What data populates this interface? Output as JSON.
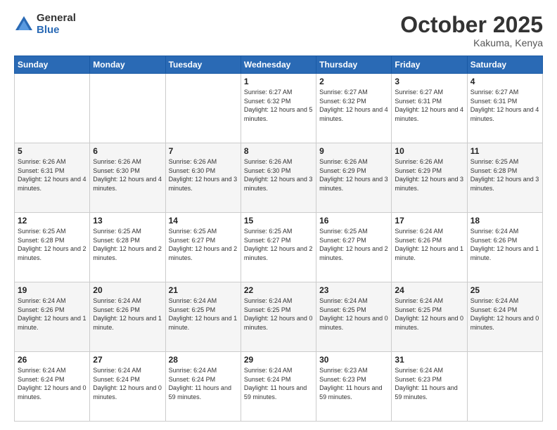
{
  "header": {
    "logo_general": "General",
    "logo_blue": "Blue",
    "month_title": "October 2025",
    "location": "Kakuma, Kenya"
  },
  "days_of_week": [
    "Sunday",
    "Monday",
    "Tuesday",
    "Wednesday",
    "Thursday",
    "Friday",
    "Saturday"
  ],
  "weeks": [
    [
      {
        "day": "",
        "info": ""
      },
      {
        "day": "",
        "info": ""
      },
      {
        "day": "",
        "info": ""
      },
      {
        "day": "1",
        "info": "Sunrise: 6:27 AM\nSunset: 6:32 PM\nDaylight: 12 hours\nand 5 minutes."
      },
      {
        "day": "2",
        "info": "Sunrise: 6:27 AM\nSunset: 6:32 PM\nDaylight: 12 hours\nand 4 minutes."
      },
      {
        "day": "3",
        "info": "Sunrise: 6:27 AM\nSunset: 6:31 PM\nDaylight: 12 hours\nand 4 minutes."
      },
      {
        "day": "4",
        "info": "Sunrise: 6:27 AM\nSunset: 6:31 PM\nDaylight: 12 hours\nand 4 minutes."
      }
    ],
    [
      {
        "day": "5",
        "info": "Sunrise: 6:26 AM\nSunset: 6:31 PM\nDaylight: 12 hours\nand 4 minutes."
      },
      {
        "day": "6",
        "info": "Sunrise: 6:26 AM\nSunset: 6:30 PM\nDaylight: 12 hours\nand 4 minutes."
      },
      {
        "day": "7",
        "info": "Sunrise: 6:26 AM\nSunset: 6:30 PM\nDaylight: 12 hours\nand 3 minutes."
      },
      {
        "day": "8",
        "info": "Sunrise: 6:26 AM\nSunset: 6:30 PM\nDaylight: 12 hours\nand 3 minutes."
      },
      {
        "day": "9",
        "info": "Sunrise: 6:26 AM\nSunset: 6:29 PM\nDaylight: 12 hours\nand 3 minutes."
      },
      {
        "day": "10",
        "info": "Sunrise: 6:26 AM\nSunset: 6:29 PM\nDaylight: 12 hours\nand 3 minutes."
      },
      {
        "day": "11",
        "info": "Sunrise: 6:25 AM\nSunset: 6:28 PM\nDaylight: 12 hours\nand 3 minutes."
      }
    ],
    [
      {
        "day": "12",
        "info": "Sunrise: 6:25 AM\nSunset: 6:28 PM\nDaylight: 12 hours\nand 2 minutes."
      },
      {
        "day": "13",
        "info": "Sunrise: 6:25 AM\nSunset: 6:28 PM\nDaylight: 12 hours\nand 2 minutes."
      },
      {
        "day": "14",
        "info": "Sunrise: 6:25 AM\nSunset: 6:27 PM\nDaylight: 12 hours\nand 2 minutes."
      },
      {
        "day": "15",
        "info": "Sunrise: 6:25 AM\nSunset: 6:27 PM\nDaylight: 12 hours\nand 2 minutes."
      },
      {
        "day": "16",
        "info": "Sunrise: 6:25 AM\nSunset: 6:27 PM\nDaylight: 12 hours\nand 2 minutes."
      },
      {
        "day": "17",
        "info": "Sunrise: 6:24 AM\nSunset: 6:26 PM\nDaylight: 12 hours\nand 1 minute."
      },
      {
        "day": "18",
        "info": "Sunrise: 6:24 AM\nSunset: 6:26 PM\nDaylight: 12 hours\nand 1 minute."
      }
    ],
    [
      {
        "day": "19",
        "info": "Sunrise: 6:24 AM\nSunset: 6:26 PM\nDaylight: 12 hours\nand 1 minute."
      },
      {
        "day": "20",
        "info": "Sunrise: 6:24 AM\nSunset: 6:26 PM\nDaylight: 12 hours\nand 1 minute."
      },
      {
        "day": "21",
        "info": "Sunrise: 6:24 AM\nSunset: 6:25 PM\nDaylight: 12 hours\nand 1 minute."
      },
      {
        "day": "22",
        "info": "Sunrise: 6:24 AM\nSunset: 6:25 PM\nDaylight: 12 hours\nand 0 minutes."
      },
      {
        "day": "23",
        "info": "Sunrise: 6:24 AM\nSunset: 6:25 PM\nDaylight: 12 hours\nand 0 minutes."
      },
      {
        "day": "24",
        "info": "Sunrise: 6:24 AM\nSunset: 6:25 PM\nDaylight: 12 hours\nand 0 minutes."
      },
      {
        "day": "25",
        "info": "Sunrise: 6:24 AM\nSunset: 6:24 PM\nDaylight: 12 hours\nand 0 minutes."
      }
    ],
    [
      {
        "day": "26",
        "info": "Sunrise: 6:24 AM\nSunset: 6:24 PM\nDaylight: 12 hours\nand 0 minutes."
      },
      {
        "day": "27",
        "info": "Sunrise: 6:24 AM\nSunset: 6:24 PM\nDaylight: 12 hours\nand 0 minutes."
      },
      {
        "day": "28",
        "info": "Sunrise: 6:24 AM\nSunset: 6:24 PM\nDaylight: 11 hours\nand 59 minutes."
      },
      {
        "day": "29",
        "info": "Sunrise: 6:24 AM\nSunset: 6:24 PM\nDaylight: 11 hours\nand 59 minutes."
      },
      {
        "day": "30",
        "info": "Sunrise: 6:23 AM\nSunset: 6:23 PM\nDaylight: 11 hours\nand 59 minutes."
      },
      {
        "day": "31",
        "info": "Sunrise: 6:24 AM\nSunset: 6:23 PM\nDaylight: 11 hours\nand 59 minutes."
      },
      {
        "day": "",
        "info": ""
      }
    ]
  ]
}
